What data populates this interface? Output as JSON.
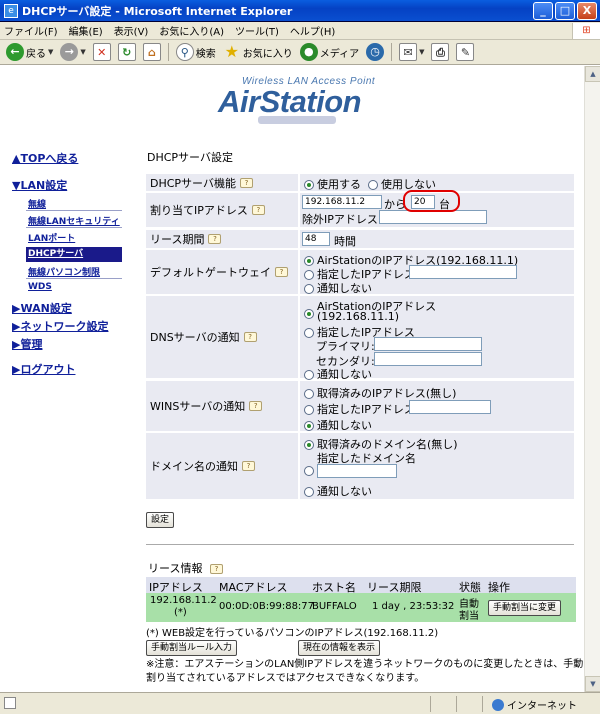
{
  "window": {
    "title": "DHCPサーバ設定 - Microsoft Internet Explorer",
    "buttons": [
      "_",
      "□",
      "X"
    ]
  },
  "menu": [
    "ファイル(F)",
    "編集(E)",
    "表示(V)",
    "お気に入り(A)",
    "ツール(T)",
    "ヘルプ(H)"
  ],
  "toolbar": {
    "back": "戻る",
    "search": "検索",
    "favorites": "お気に入り",
    "media": "メディア"
  },
  "logo": {
    "subtitle": "Wireless LAN Access Point",
    "name": "AirStation"
  },
  "nav": {
    "top": "▲TOPへ戻る",
    "lan": "▼LAN設定",
    "lan_items": [
      "無線",
      "無線LANセキュリティ",
      "LANポート",
      "DHCPサーバ",
      "無線パソコン制限",
      "WDS"
    ],
    "active": "DHCPサーバ",
    "wan": "▶WAN設定",
    "network": "▶ネットワーク設定",
    "admin": "▶管理",
    "logout": "▶ログアウト"
  },
  "page": {
    "heading": "DHCPサーバ設定"
  },
  "form": {
    "dhcp_function": {
      "label": "DHCPサーバ機能",
      "options": [
        "使用する",
        "使用しない"
      ],
      "selected": "使用する"
    },
    "assign": {
      "label": "割り当てIPアドレス",
      "start": "192.168.11.2",
      "from": "から",
      "count": "20",
      "unit": "台",
      "exclude_label": "除外IPアドレス",
      "exclude_value": ""
    },
    "lease": {
      "label": "リース期間",
      "value": "48",
      "unit": "時間"
    },
    "gateway": {
      "label": "デフォルトゲートウェイ",
      "options": [
        "AirStationのIPアドレス(192.168.11.1)",
        "指定したIPアドレス",
        "通知しない"
      ],
      "selected": 0
    },
    "dns": {
      "label": "DNSサーバの通知",
      "option1_line1": "AirStationのIPアドレス",
      "option1_line2": "(192.168.11.1)",
      "option2": "指定したIPアドレス",
      "primary": "プライマリ:",
      "secondary": "セカンダリ:",
      "option3": "通知しない",
      "selected": 0
    },
    "wins": {
      "label": "WINSサーバの通知",
      "options": [
        "取得済みのIPアドレス(無し)",
        "指定したIPアドレス",
        "通知しない"
      ],
      "selected": 2
    },
    "domain": {
      "label": "ドメイン名の通知",
      "options": [
        "取得済みのドメイン名(無し)",
        "指定したドメイン名",
        "通知しない"
      ],
      "selected": 0
    },
    "submit": "設定"
  },
  "lease_info": {
    "title": "リース情報",
    "headers": [
      "IPアドレス",
      "MACアドレス",
      "ホスト名",
      "リース期限",
      "状態",
      "操作"
    ],
    "rows": [
      {
        "ip": "192.168.11.2",
        "ip_mark": "(*)",
        "mac": "00:0D:0B:99:88:77",
        "host": "BUFFALO",
        "expiry": "1 day , 23:53:32",
        "status_1": "自動",
        "status_2": "割当",
        "action": "手動割当に変更"
      }
    ],
    "note": "(*) WEB設定を行っているパソコンのIPアドレス(192.168.11.2)",
    "btn_manual": "手動割当ルール入力",
    "btn_show": "現在の情報を表示",
    "warning": "※注意：エアステーションのLAN側IPアドレスを違うネットワークのものに変更したときは、手動割り当てされているアドレスではアクセスできなくなります。"
  },
  "status": {
    "zone": "インターネット"
  }
}
